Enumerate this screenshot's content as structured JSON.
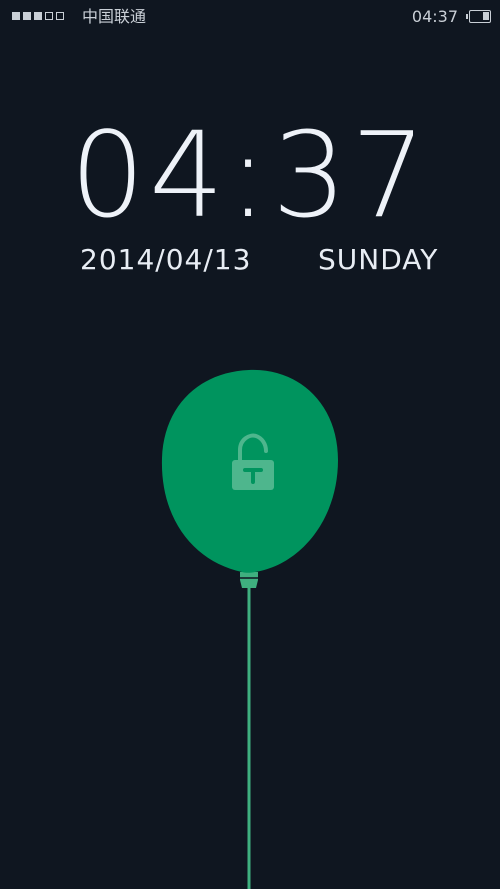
{
  "status_bar": {
    "signal_bars_filled": 3,
    "signal_bars_total": 5,
    "carrier": "中国联通",
    "time": "04:37",
    "battery_level": 0.35
  },
  "lock_screen": {
    "time": "04:37",
    "date": "2014/04/13",
    "weekday": "SUNDAY"
  },
  "unlock_balloon": {
    "icon": "unlock-padlock-icon",
    "color": "#00945e",
    "string_color": "#3fb07f"
  },
  "colors": {
    "background": "#0f1620",
    "text": "#e8edf4"
  }
}
